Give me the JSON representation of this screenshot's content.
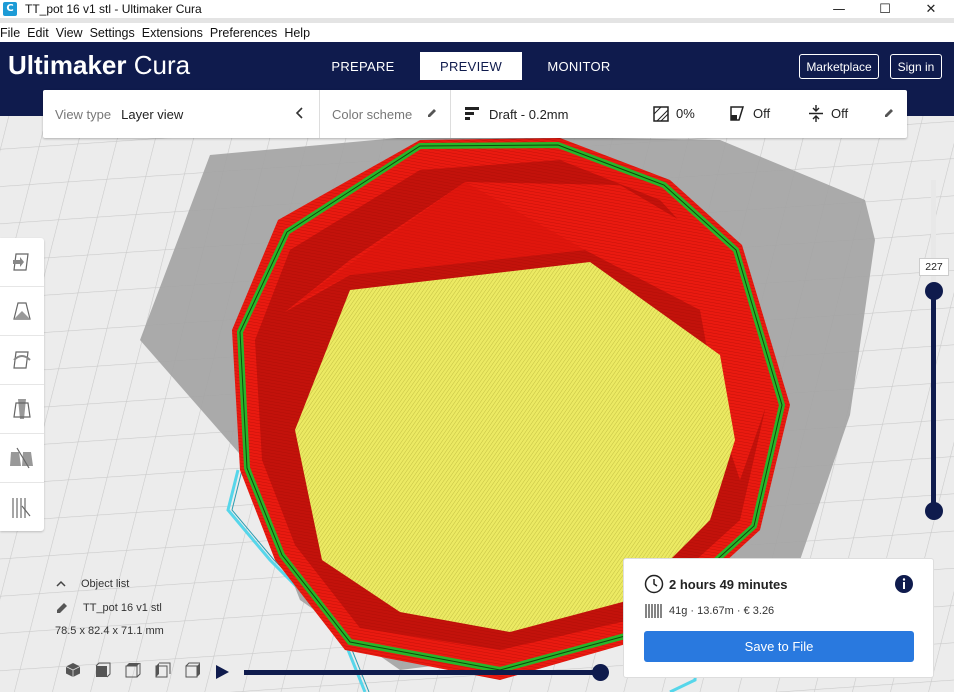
{
  "window": {
    "app_icon": "C",
    "title": "TT_pot 16  v1 stl  - Ultimaker Cura",
    "minimize": "—",
    "maximize": "☐",
    "close": "✕"
  },
  "menu": {
    "items": [
      "File",
      "Edit",
      "View",
      "Settings",
      "Extensions",
      "Preferences",
      "Help"
    ]
  },
  "header": {
    "brand_bold": "Ultimaker",
    "brand_light": " Cura",
    "tabs": [
      {
        "label": "PREPARE",
        "active": false
      },
      {
        "label": "PREVIEW",
        "active": true
      },
      {
        "label": "MONITOR",
        "active": false
      }
    ],
    "marketplace": "Marketplace",
    "signin": "Sign in"
  },
  "toolbar": {
    "view_type_label": "View type",
    "view_type_value": "Layer view",
    "color_scheme_label": "Color scheme",
    "profile": "Draft - 0.2mm",
    "infill": "0%",
    "support": "Off",
    "adhesion": "Off"
  },
  "layer_slider": {
    "current_layer": "227"
  },
  "object_list": {
    "header": "Object list",
    "object_name": "TT_pot 16  v1 stl",
    "dimensions": "78.5 x 82.4 x 71.1 mm"
  },
  "print_info": {
    "time": "2 hours 49 minutes",
    "material": "41g · 13.67m · € 3.26",
    "save_button": "Save to File"
  },
  "colors": {
    "header_bg": "#0f1b4d",
    "accent": "#2979df",
    "wall": "#e8170f",
    "inner_wall": "#3ec43a",
    "infill": "#e8e55a",
    "travel": "#56d6ea",
    "shadow": "#9a9a9a"
  },
  "icons": {
    "view_type_collapse": "chevron-left-icon",
    "edit": "pencil-icon",
    "clock": "clock-icon",
    "info": "info-icon",
    "material": "spool-icon",
    "play": "play-icon"
  }
}
